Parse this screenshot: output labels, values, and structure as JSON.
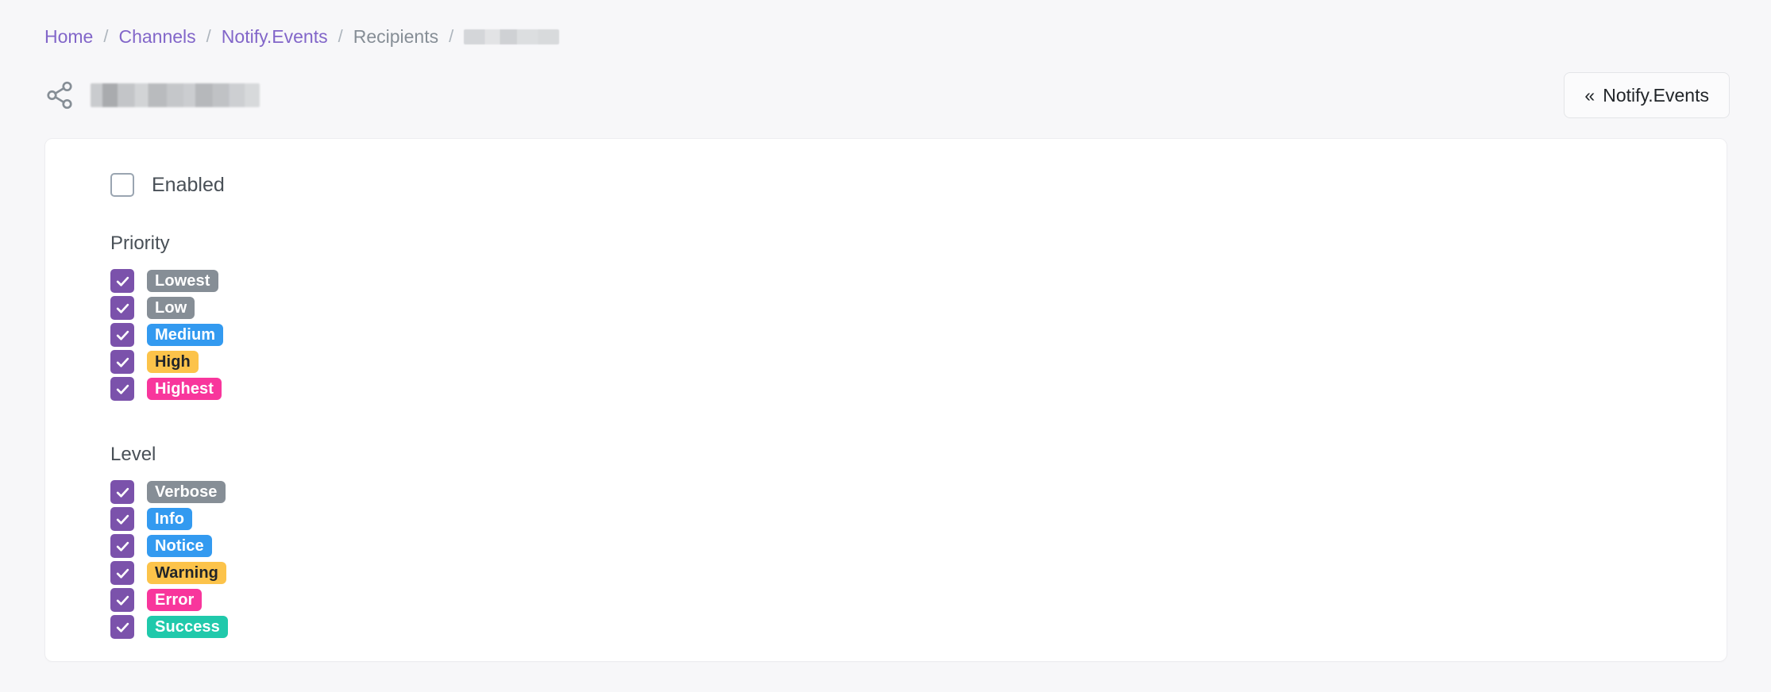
{
  "breadcrumb": {
    "separator": "/",
    "items": [
      {
        "label": "Home",
        "type": "link",
        "name": "breadcrumb-home"
      },
      {
        "label": "Channels",
        "type": "link",
        "name": "breadcrumb-channels"
      },
      {
        "label": "Notify.Events",
        "type": "link",
        "name": "breadcrumb-notify-events"
      },
      {
        "label": "Recipients",
        "type": "static",
        "name": "breadcrumb-recipients"
      },
      {
        "label": "",
        "type": "redacted",
        "name": "breadcrumb-redacted"
      }
    ]
  },
  "header": {
    "icon": "share-icon",
    "title_redacted": true,
    "title": "",
    "back_button": {
      "chevrons": "«",
      "label": "Notify.Events"
    }
  },
  "form": {
    "enabled": {
      "label": "Enabled",
      "checked": false
    },
    "priority": {
      "title": "Priority",
      "options": [
        {
          "label": "Lowest",
          "checked": true,
          "bg": "#868e96",
          "fg": "#ffffff"
        },
        {
          "label": "Low",
          "checked": true,
          "bg": "#868e96",
          "fg": "#ffffff"
        },
        {
          "label": "Medium",
          "checked": true,
          "bg": "#339af0",
          "fg": "#ffffff"
        },
        {
          "label": "High",
          "checked": true,
          "bg": "#fcc34a",
          "fg": "#212529"
        },
        {
          "label": "Highest",
          "checked": true,
          "bg": "#f8369c",
          "fg": "#ffffff"
        }
      ]
    },
    "level": {
      "title": "Level",
      "options": [
        {
          "label": "Verbose",
          "checked": true,
          "bg": "#868e96",
          "fg": "#ffffff"
        },
        {
          "label": "Info",
          "checked": true,
          "bg": "#339af0",
          "fg": "#ffffff"
        },
        {
          "label": "Notice",
          "checked": true,
          "bg": "#339af0",
          "fg": "#ffffff"
        },
        {
          "label": "Warning",
          "checked": true,
          "bg": "#fcc34a",
          "fg": "#212529"
        },
        {
          "label": "Error",
          "checked": true,
          "bg": "#f8369c",
          "fg": "#ffffff"
        },
        {
          "label": "Success",
          "checked": true,
          "bg": "#20c9ab",
          "fg": "#ffffff"
        }
      ]
    }
  },
  "colors": {
    "page_bg": "#f7f7f9",
    "card_bg": "#ffffff",
    "link": "#8266c9",
    "muted_text": "#868e96",
    "checkbox_accent": "#7b52ab"
  }
}
